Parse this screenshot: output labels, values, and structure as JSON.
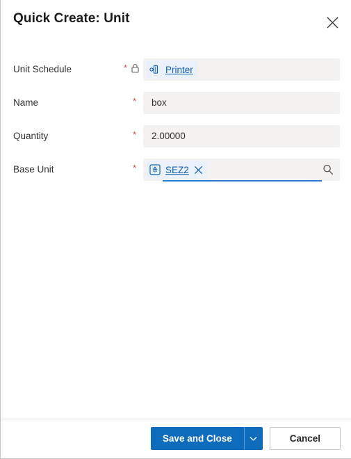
{
  "dialog": {
    "title": "Quick Create: Unit",
    "close_icon": "close-icon"
  },
  "colors": {
    "accent_bar": "#2f3145",
    "primary_button": "#0f6cbd",
    "link": "#1060b6",
    "required_star": "#c94f4f",
    "field_background": "#f3f2f1",
    "chip_background": "#eaf1fb",
    "focus_underline": "#2b79d2"
  },
  "form": {
    "fields": [
      {
        "label": "Unit Schedule",
        "required_marker": "*",
        "locked": true,
        "lock_icon": "lock-icon",
        "type": "lookup-chip",
        "chip": {
          "icon": "printer-entity-icon",
          "text": "Printer",
          "removable": false
        }
      },
      {
        "label": "Name",
        "required_marker": "*",
        "locked": false,
        "type": "text",
        "value": "box",
        "placeholder": ""
      },
      {
        "label": "Quantity",
        "required_marker": "*",
        "locked": false,
        "type": "text",
        "value": "2.00000",
        "placeholder": ""
      },
      {
        "label": "Base Unit",
        "required_marker": "*",
        "locked": false,
        "type": "lookup",
        "focused": true,
        "search_icon": "search-icon",
        "chip": {
          "icon": "unit-entity-icon",
          "text": "SEZ2",
          "remove_icon": "remove-chip-icon",
          "removable": true
        }
      }
    ]
  },
  "footer": {
    "save_label": "Save and Close",
    "save_dropdown_icon": "chevron-down-icon",
    "cancel_label": "Cancel"
  }
}
